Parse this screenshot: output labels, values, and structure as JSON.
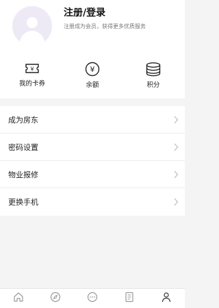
{
  "profile": {
    "title": "注册/登录",
    "subtitle": "注册成为会员，获得更多优质服务"
  },
  "quick_actions": [
    {
      "label": "我的卡券",
      "icon": "coupon-ticket-icon",
      "glyph": "¥"
    },
    {
      "label": "余额",
      "icon": "yen-coin-icon",
      "glyph": "¥"
    },
    {
      "label": "积分",
      "icon": "coin-stack-icon"
    }
  ],
  "menu": [
    {
      "label": "成为房东"
    },
    {
      "label": "密码设置"
    },
    {
      "label": "物业报修"
    },
    {
      "label": "更换手机"
    }
  ],
  "tabbar": {
    "items": [
      {
        "label": "",
        "icon": "home-icon"
      },
      {
        "label": "",
        "icon": "compass-icon"
      },
      {
        "label": "",
        "icon": "message-icon"
      },
      {
        "label": "",
        "icon": "document-icon"
      },
      {
        "label": "",
        "icon": "person-icon",
        "active": true
      }
    ]
  },
  "colors": {
    "accent": "#e74c3c",
    "background": "#f4f4f5",
    "card": "#ffffff",
    "avatar_bg": "#edeaf6",
    "inactive_icon": "#999999"
  }
}
